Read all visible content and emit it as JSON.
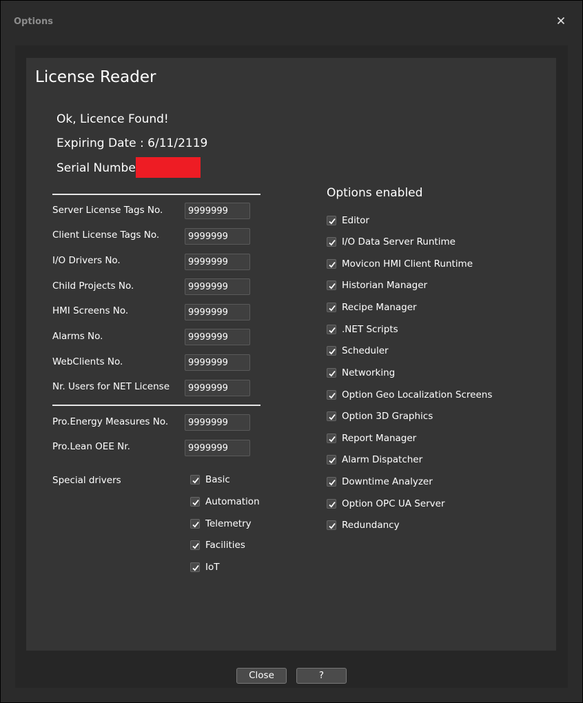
{
  "window": {
    "title": "Options"
  },
  "heading": "License Reader",
  "status": {
    "found": "Ok, Licence Found!",
    "expiring": "Expiring Date : 6/11/2119",
    "serial_label": "Serial Number"
  },
  "fields_group1": [
    {
      "label": "Server License Tags No.",
      "value": "9999999"
    },
    {
      "label": "Client License Tags No.",
      "value": "9999999"
    },
    {
      "label": "I/O Drivers No.",
      "value": "9999999"
    },
    {
      "label": "Child Projects No.",
      "value": "9999999"
    },
    {
      "label": "HMI Screens No.",
      "value": "9999999"
    },
    {
      "label": "Alarms No.",
      "value": "9999999"
    },
    {
      "label": "WebClients No.",
      "value": "9999999"
    },
    {
      "label": "Nr. Users for NET License",
      "value": "9999999"
    }
  ],
  "fields_group2": [
    {
      "label": "Pro.Energy Measures No.",
      "value": "9999999"
    },
    {
      "label": "Pro.Lean OEE Nr.",
      "value": "9999999"
    }
  ],
  "special_drivers": {
    "label": "Special drivers",
    "items": [
      {
        "label": "Basic",
        "checked": true
      },
      {
        "label": "Automation",
        "checked": true
      },
      {
        "label": "Telemetry",
        "checked": true
      },
      {
        "label": "Facilities",
        "checked": true
      },
      {
        "label": "IoT",
        "checked": true
      }
    ]
  },
  "options": {
    "title": "Options enabled",
    "items": [
      {
        "label": "Editor",
        "checked": true
      },
      {
        "label": "I/O Data Server Runtime",
        "checked": true
      },
      {
        "label": "Movicon HMI Client Runtime",
        "checked": true
      },
      {
        "label": "Historian Manager",
        "checked": true
      },
      {
        "label": "Recipe Manager",
        "checked": true
      },
      {
        "label": ".NET Scripts",
        "checked": true
      },
      {
        "label": "Scheduler",
        "checked": true
      },
      {
        "label": "Networking",
        "checked": true
      },
      {
        "label": "Option Geo Localization Screens",
        "checked": true
      },
      {
        "label": "Option 3D Graphics",
        "checked": true
      },
      {
        "label": "Report Manager",
        "checked": true
      },
      {
        "label": "Alarm Dispatcher",
        "checked": true
      },
      {
        "label": "Downtime Analyzer",
        "checked": true
      },
      {
        "label": "Option OPC UA Server",
        "checked": true
      },
      {
        "label": "Redundancy",
        "checked": true
      }
    ]
  },
  "buttons": {
    "close": "Close",
    "help": "?"
  }
}
